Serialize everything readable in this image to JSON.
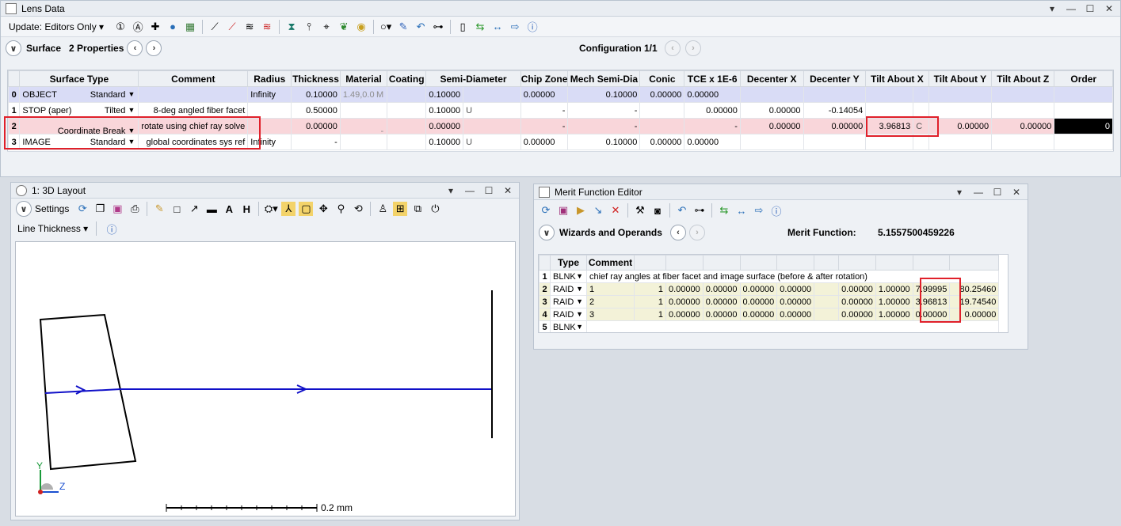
{
  "lens": {
    "title": "Lens Data",
    "update_label": "Update: Editors Only",
    "surface_label": "Surface",
    "properties_label": "2 Properties",
    "config_label": "Configuration 1/1",
    "headers": [
      "Surface Type",
      "Comment",
      "Radius",
      "Thickness",
      "Material",
      "Coating",
      "Semi-Diameter",
      "Chip Zone",
      "Mech Semi-Dia",
      "Conic",
      "TCE x 1E-6",
      "Decenter X",
      "Decenter Y",
      "Tilt About X",
      "Tilt About Y",
      "Tilt About Z",
      "Order"
    ],
    "rows": [
      {
        "idx": "0",
        "name": "OBJECT",
        "type": "Standard",
        "comment": "",
        "radius": "Infinity",
        "thickness": "0.10000",
        "material": "1.49,0.0",
        "mat_flag": "M",
        "coating": "",
        "semidia": "0.10000",
        "semidia_flag": "",
        "chip": "0.00000",
        "mech": "0.10000",
        "conic": "0.00000",
        "tce": "0.00000",
        "decx": "",
        "decy": "",
        "tiltx": "",
        "tiltx_flag": "",
        "tilty": "",
        "tiltz": "",
        "order": ""
      },
      {
        "idx": "1",
        "name": "STOP (aper)",
        "type": "Tilted",
        "comment": "8-deg angled fiber facet",
        "radius": "",
        "thickness": "0.50000",
        "material": "",
        "mat_flag": "",
        "coating": "",
        "semidia": "0.10000",
        "semidia_flag": "U",
        "chip": "-",
        "mech": "-",
        "conic": "",
        "tce": "0.00000",
        "decx": "0.00000",
        "decy": "-0.14054",
        "tiltx": "",
        "tiltx_flag": "",
        "tilty": "",
        "tiltz": "",
        "order": ""
      },
      {
        "idx": "2",
        "name": "",
        "type": "Coordinate Break",
        "comment": "rotate using chief ray solve",
        "radius": "",
        "thickness": "0.00000",
        "material": "-",
        "mat_flag": "",
        "coating": "",
        "semidia": "0.00000",
        "semidia_flag": "",
        "chip": "-",
        "mech": "-",
        "conic": "",
        "tce": "-",
        "decx": "0.00000",
        "decy": "0.00000",
        "tiltx": "3.96813",
        "tiltx_flag": "C",
        "tilty": "0.00000",
        "tiltz": "0.00000",
        "order": "0"
      },
      {
        "idx": "3",
        "name": "IMAGE",
        "type": "Standard",
        "comment": "global coordinates sys ref",
        "radius": "Infinity",
        "thickness": "-",
        "material": "",
        "mat_flag": "",
        "coating": "",
        "semidia": "0.10000",
        "semidia_flag": "U",
        "chip": "0.00000",
        "mech": "0.10000",
        "conic": "0.00000",
        "tce": "0.00000",
        "decx": "",
        "decy": "",
        "tiltx": "",
        "tiltx_flag": "",
        "tilty": "",
        "tiltz": "",
        "order": ""
      }
    ]
  },
  "layout": {
    "title": "1: 3D Layout",
    "settings_label": "Settings",
    "line_thickness_label": "Line Thickness",
    "axis_y": "Y",
    "axis_z": "Z",
    "scale_label": "0.2 mm"
  },
  "merit": {
    "title": "Merit Function Editor",
    "wizards_label": "Wizards and Operands",
    "mf_label": "Merit Function:",
    "mf_value": "5.1557500459226",
    "headers": [
      "Type",
      "Comment",
      "",
      "",
      "",
      "",
      "",
      "",
      "",
      "",
      ""
    ],
    "rows": [
      {
        "idx": "1",
        "type": "BLNK",
        "comment": "chief ray angles at fiber facet and image surface (before & after rotation)",
        "cells": []
      },
      {
        "idx": "2",
        "type": "RAID",
        "comment": "1",
        "cells": [
          "1",
          "0.00000",
          "0.00000",
          "0.00000",
          "0.00000",
          "",
          "0.00000",
          "1.00000",
          "7.99995",
          "80.25460"
        ]
      },
      {
        "idx": "3",
        "type": "RAID",
        "comment": "2",
        "cells": [
          "1",
          "0.00000",
          "0.00000",
          "0.00000",
          "0.00000",
          "",
          "0.00000",
          "1.00000",
          "3.96813",
          "19.74540"
        ]
      },
      {
        "idx": "4",
        "type": "RAID",
        "comment": "3",
        "cells": [
          "1",
          "0.00000",
          "0.00000",
          "0.00000",
          "0.00000",
          "",
          "0.00000",
          "1.00000",
          "0.00000",
          "0.00000"
        ]
      },
      {
        "idx": "5",
        "type": "BLNK",
        "comment": "",
        "cells": []
      }
    ]
  },
  "colors": {
    "highlight": "#e0202a",
    "ray": "#1010c8",
    "object_row": "#d9dcf6",
    "cb_row": "#f9d6da",
    "operand_row": "#f3f2d8"
  }
}
